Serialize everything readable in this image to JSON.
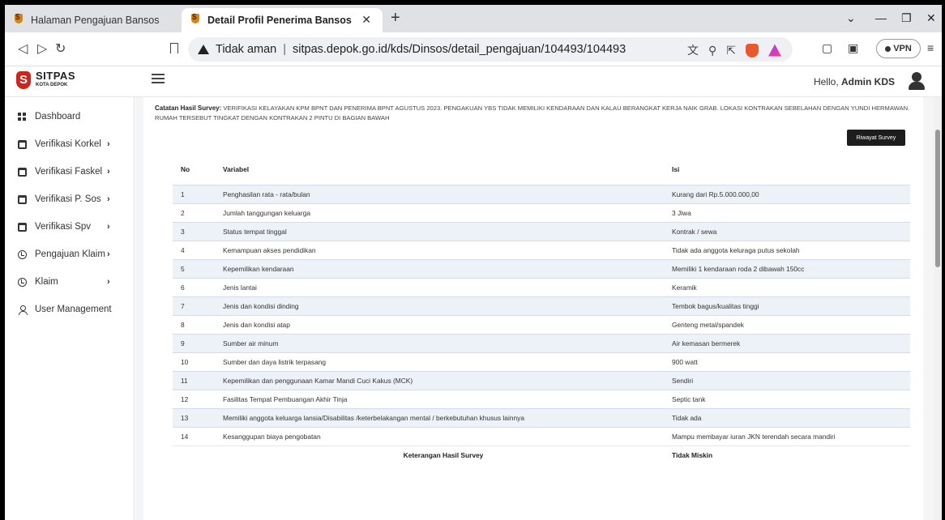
{
  "browser": {
    "tabs": [
      {
        "title": "Halaman Pengajuan Bansos",
        "active": false
      },
      {
        "title": "Detail Profil Penerima Bansos",
        "active": true
      }
    ],
    "security_label": "Tidak aman",
    "url": "sitpas.depok.go.id/kds/Dinsos/detail_pengajuan/104493/104493",
    "vpn_label": "VPN"
  },
  "app": {
    "logo_title": "SITPAS",
    "logo_subtitle": "KOTA DEPOK",
    "greeting_prefix": "Hello,",
    "user_name": "Admin KDS"
  },
  "sidebar": {
    "items": [
      {
        "label": "Dashboard",
        "icon": "grid-icon",
        "has_chevron": false
      },
      {
        "label": "Verifikasi Korkel",
        "icon": "calendar-icon",
        "has_chevron": true
      },
      {
        "label": "Verifikasi Faskel",
        "icon": "calendar-icon",
        "has_chevron": true
      },
      {
        "label": "Verifikasi P. Sos",
        "icon": "calendar-icon",
        "has_chevron": true
      },
      {
        "label": "Verifikasi Spv",
        "icon": "calendar-icon",
        "has_chevron": true
      },
      {
        "label": "Pengajuan Klaim",
        "icon": "clock-icon",
        "has_chevron": true
      },
      {
        "label": "Klaim",
        "icon": "clock-icon",
        "has_chevron": true
      },
      {
        "label": "User Management",
        "icon": "user-icon",
        "has_chevron": false
      }
    ]
  },
  "survey": {
    "note_label": "Catatan Hasil Survey:",
    "note_text": "VERIFIKASI KELAYAKAN KPM BPNT DAN PENERIMA BPNT AGUSTUS 2023. PENGAKUAN YBS TIDAK MEMILIKI KENDARAAN DAN KALAU BERANGKAT KERJA NAIK GRAB. LOKASI KONTRAKAN SEBELAHAN DENGAN YUNDI HERMAWAN. RUMAH TERSEBUT TINGKAT DENGAN KONTRAKAN 2 PINTU DI BAGIAN BAWAH",
    "history_button": "Riwayat Survey",
    "table": {
      "headers": {
        "no": "No",
        "variable": "Variabel",
        "value": "Isi"
      },
      "rows": [
        {
          "no": "1",
          "variable": "Penghasilan rata - rata/bulan",
          "value": "Kurang dari Rp.5.000.000,00"
        },
        {
          "no": "2",
          "variable": "Jumlah tanggungan keluarga",
          "value": "3 Jiwa"
        },
        {
          "no": "3",
          "variable": "Status tempat tinggal",
          "value": "Kontrak / sewa"
        },
        {
          "no": "4",
          "variable": "Kemampuan akses pendidikan",
          "value": "Tidak ada anggota keluraga putus sekolah"
        },
        {
          "no": "5",
          "variable": "Kepemilikan kendaraan",
          "value": "Memiliki 1 kendaraan roda 2 dibawah 150cc"
        },
        {
          "no": "6",
          "variable": "Jenis lantai",
          "value": "Keramik"
        },
        {
          "no": "7",
          "variable": "Jenis dan kondisi dinding",
          "value": "Tembok bagus/kualitas tinggi"
        },
        {
          "no": "8",
          "variable": "Jenis dan kondisi atap",
          "value": "Genteng metal/spandek"
        },
        {
          "no": "9",
          "variable": "Sumber air minum",
          "value": "Air kemasan bermerek"
        },
        {
          "no": "10",
          "variable": "Sumber dan daya listrik terpasang",
          "value": "900 watt"
        },
        {
          "no": "11",
          "variable": "Kepemilikan dan penggunaan Kamar Mandi Cuci Kakus (MCK)",
          "value": "Sendiri"
        },
        {
          "no": "12",
          "variable": "Fasilitas Tempat Pembuangan Akhir Tinja",
          "value": "Septic tank"
        },
        {
          "no": "13",
          "variable": "Memiliki anggota keluarga lansia/Disabilitas /keterbelakangan mental / berkebutuhan khusus lainnya",
          "value": "Tidak ada"
        },
        {
          "no": "14",
          "variable": "Kesanggupan biaya pengobatan",
          "value": "Mampu membayar iuran JKN terendah secara mandiri"
        }
      ],
      "footer": {
        "label": "Keterangan Hasil Survey",
        "value": "Tidak Miskin"
      }
    }
  }
}
